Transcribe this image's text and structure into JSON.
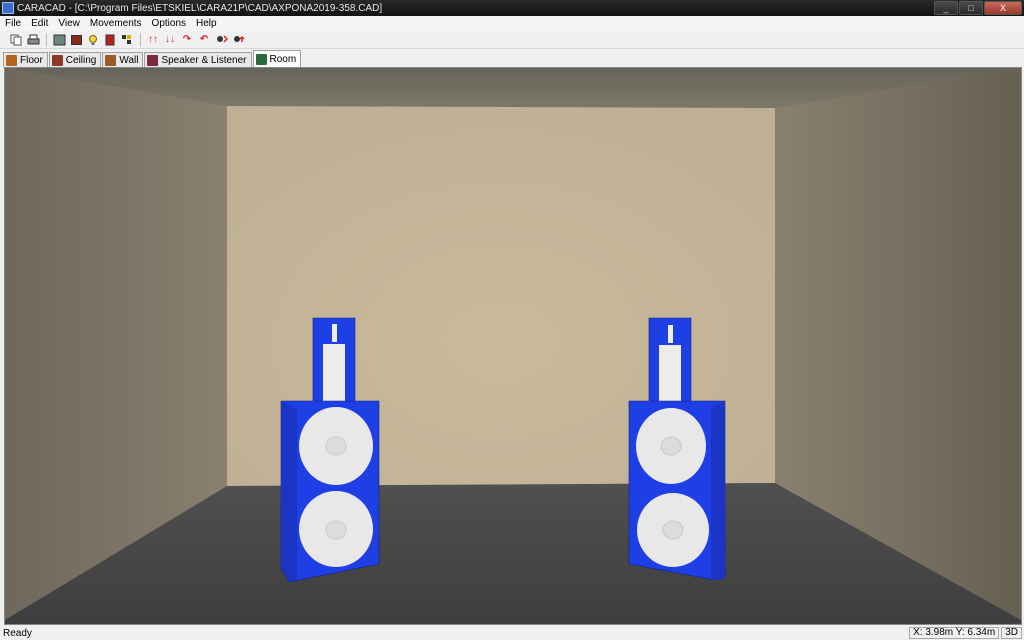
{
  "window": {
    "title": "CARACAD - [C:\\Program Files\\ETSKIEL\\CARA21P\\CAD\\AXPONA2019-358.CAD]",
    "minimize": "_",
    "maximize": "□",
    "close": "X"
  },
  "menu": {
    "items": [
      "File",
      "Edit",
      "View",
      "Movements",
      "Options",
      "Help"
    ]
  },
  "toolbar": {
    "up_arrows": "↑↑",
    "down_arrows": "↓↓",
    "rotate_right": "↷",
    "rotate_left": "↶"
  },
  "tabs": [
    {
      "label": "Floor",
      "icon_color": "#b5651d"
    },
    {
      "label": "Ceiling",
      "icon_color": "#8b3a2a"
    },
    {
      "label": "Wall",
      "icon_color": "#9b5a2a"
    },
    {
      "label": "Speaker & Listener",
      "icon_color": "#7a2a3a"
    },
    {
      "label": "Room",
      "icon_color": "#2a6a3a",
      "active": true
    }
  ],
  "scene": {
    "back_wall_color": "#c9b99a",
    "side_wall_color": "#7a7062",
    "floor_color": "#4a4a4a",
    "speaker_color": "#1f3fe6",
    "driver_color": "#e6e6e6"
  },
  "status": {
    "text": "Ready",
    "coords": "X: 3.98m Y: 6.34m",
    "mode": "3D"
  }
}
